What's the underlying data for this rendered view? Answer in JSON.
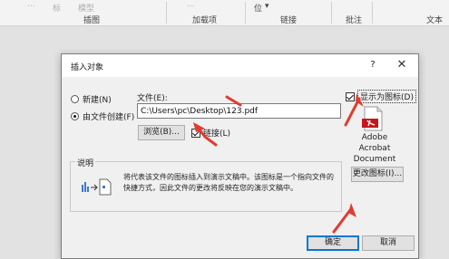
{
  "ribbon": {
    "faded_text": "标",
    "faded_text2": "模型",
    "faded_text3": "...",
    "faded_text4": "位",
    "group_labels": [
      "插图",
      "加载项",
      "链接",
      "批注",
      "文本"
    ]
  },
  "dialog": {
    "title": "插入对象",
    "help_label": "?",
    "close_label": "✕",
    "options": {
      "create_new": "新建(N)",
      "create_from_file": "由文件创建(F)"
    },
    "file_label": "文件(E):",
    "file_path": "C:\\Users\\pc\\Desktop\\123.pdf",
    "browse_label": "浏览(B)...",
    "link_label": "链接(L)",
    "display_as_icon_label": "显示为图标(D)",
    "icon_caption": [
      "Adobe",
      "Acrobat",
      "Document"
    ],
    "change_icon_label": "更改图标(I)...",
    "result_title": "说明",
    "result_text": "将代表该文件的图标插入到演示文稿中。该图标是一个指向文件的快捷方式，因此文件的更改将反映在您的演示文稿中。",
    "ok_label": "确定",
    "cancel_label": "取消",
    "state": {
      "create_from_file_selected": true,
      "link_checked": true,
      "display_as_icon_checked": true
    }
  },
  "colors": {
    "annotation_arrow": "#e03c31",
    "default_button_border": "#0078d7"
  }
}
